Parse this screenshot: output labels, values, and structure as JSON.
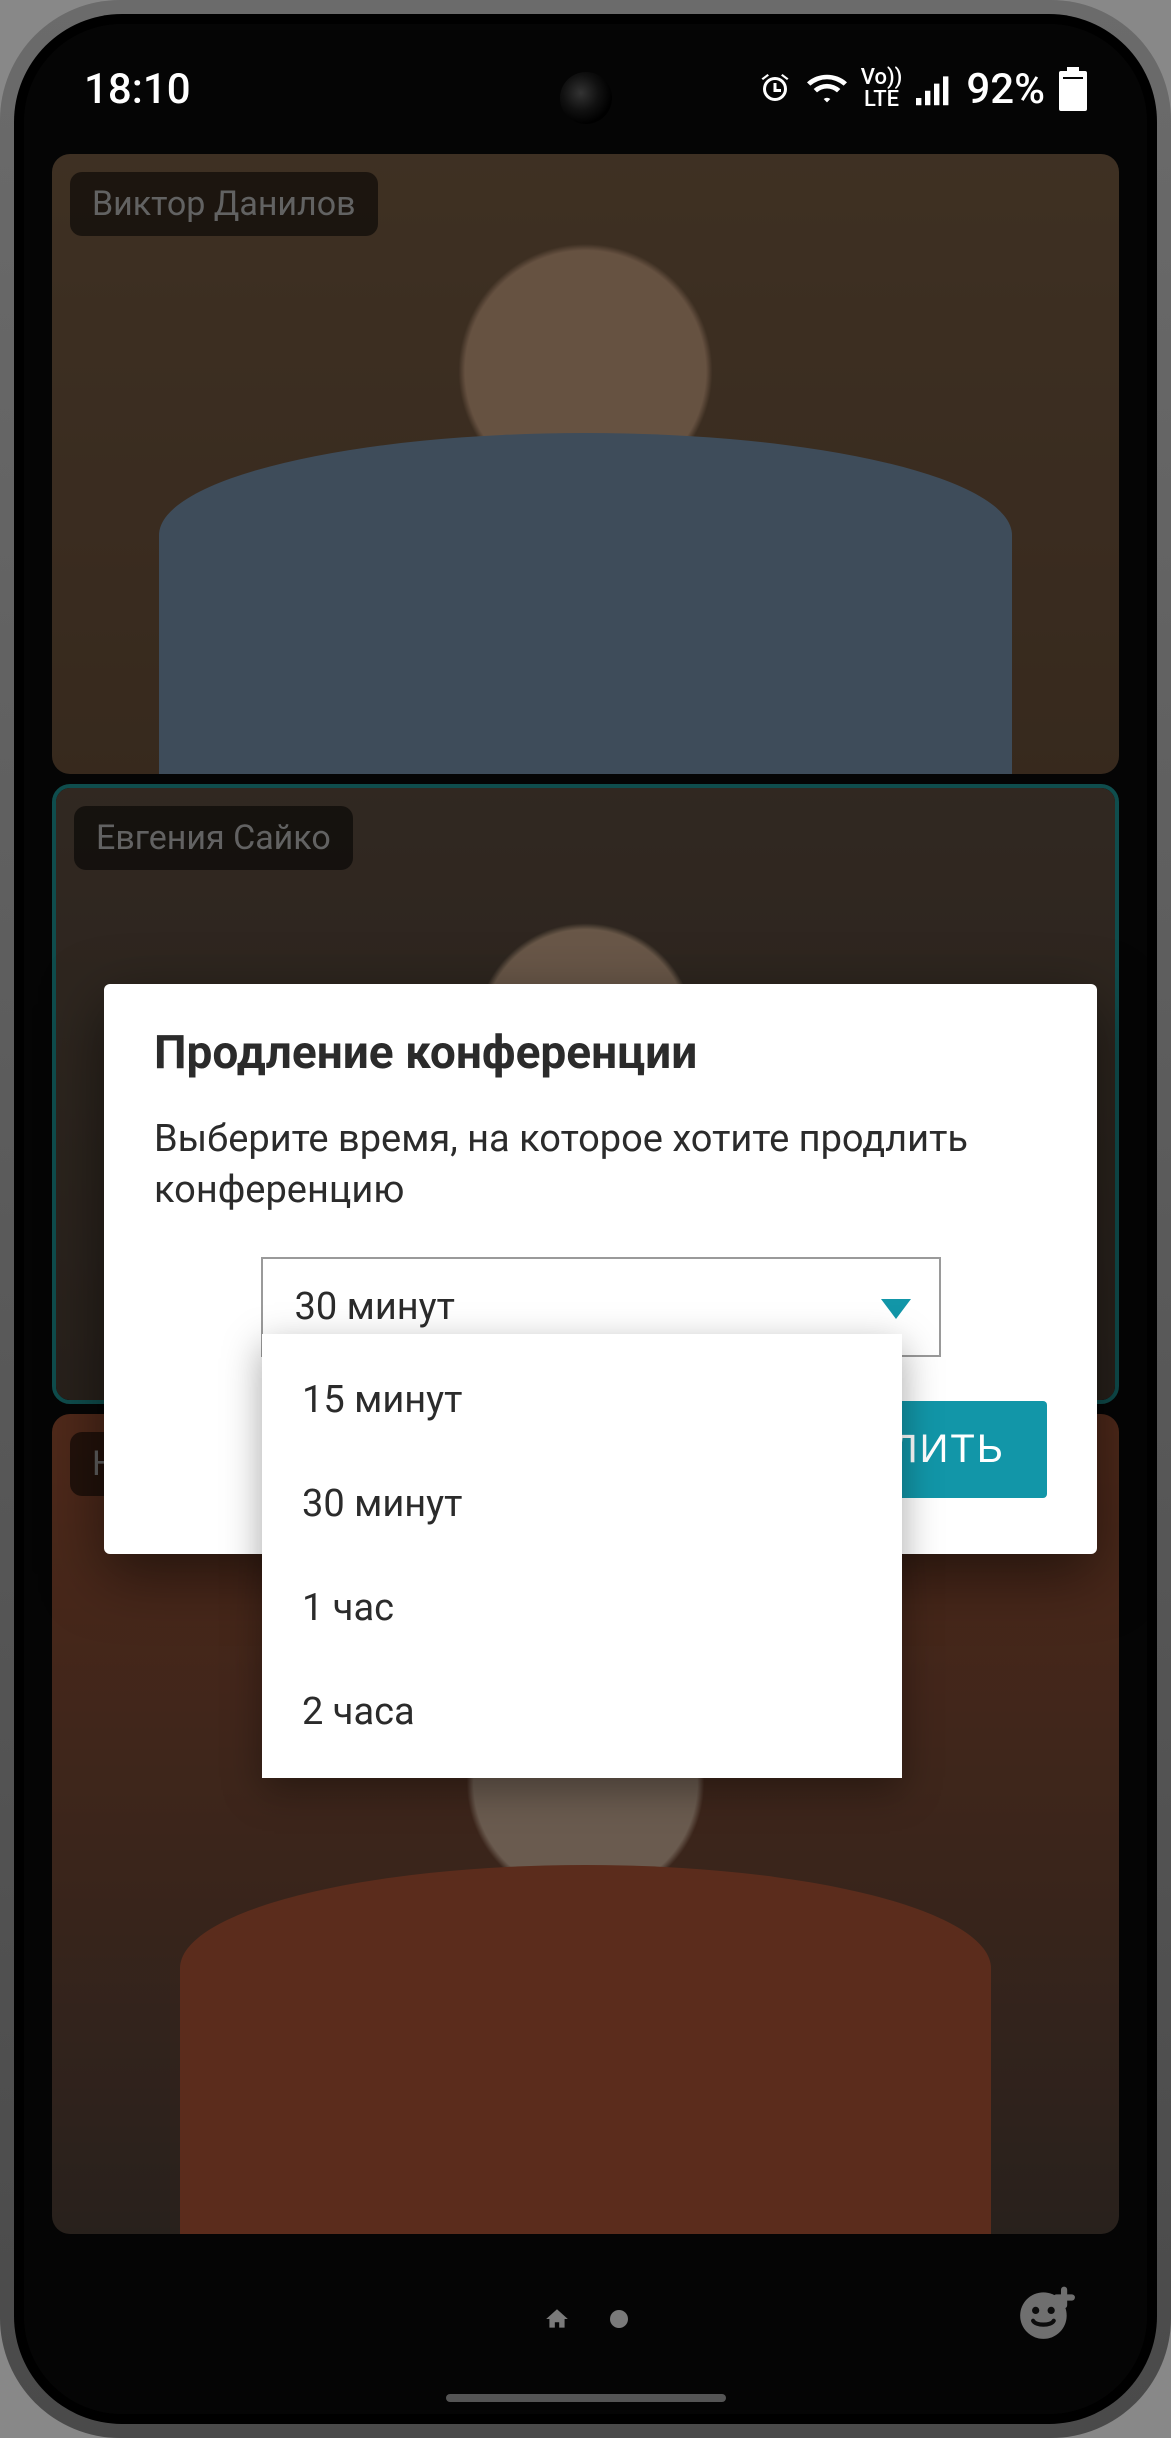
{
  "status": {
    "time": "18:10",
    "battery_pct": "92%",
    "icons": [
      "alarm",
      "wifi",
      "volte",
      "signal",
      "battery"
    ]
  },
  "participants": [
    {
      "name": "Виктор Данилов"
    },
    {
      "name": "Евгения Сайко"
    },
    {
      "name": "Наталья"
    }
  ],
  "dialog": {
    "title": "Продление конференции",
    "message": "Выберите время, на которое хотите продлить конференцию",
    "selected": "30 минут",
    "options": [
      "15 минут",
      "30 минут",
      "1 час",
      "2 часа"
    ],
    "extend_label": "ПРОДЛИТЬ"
  },
  "colors": {
    "accent": "#1296a8"
  }
}
